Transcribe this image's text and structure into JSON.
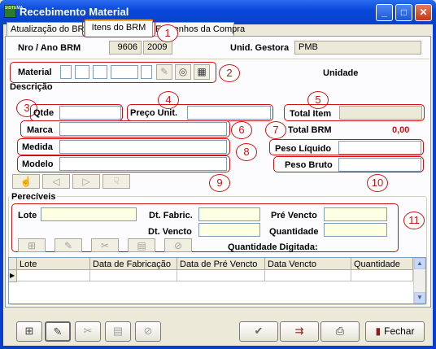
{
  "window": {
    "title": "Recebimento Material",
    "app_icon_text": "SISTEMA",
    "minimize": "_",
    "maximize": "□",
    "close": "✕"
  },
  "tabs": [
    {
      "label": "Atualização do BRM"
    },
    {
      "label": "Itens do BRM"
    },
    {
      "label": "Empenhos da Compra"
    }
  ],
  "header": {
    "nro_label": "Nro / Ano BRM",
    "nro_value": "9606",
    "ano_value": "2009",
    "unidade_label": "Unid. Gestora",
    "unidade_value": "PMB"
  },
  "item": {
    "material_label": "Material",
    "unidade_label": "Unidade",
    "descricao_label": "Descrição",
    "qtde_label": "Qtde",
    "preco_label": "Preço Unit.",
    "total_item_label": "Total Item",
    "marca_label": "Marca",
    "total_brm_label": "Total BRM",
    "total_brm_value": "0,00",
    "medida_label": "Medida",
    "peso_liquido_label": "Peso Líquido",
    "modelo_label": "Modelo",
    "peso_bruto_label": "Peso Bruto"
  },
  "pereciveis": {
    "title": "Perecíveis",
    "lote_label": "Lote",
    "dt_fabric_label": "Dt. Fabric.",
    "pre_vencto_label": "Pré Vencto",
    "dt_vencto_label": "Dt. Vencto",
    "quantidade_label": "Quantidade",
    "qtd_digitada_label": "Quantidade Digitada:",
    "columns": [
      "Lote",
      "Data de Fabricação",
      "Data de Pré Vencto",
      "Data Vencto",
      "Quantidade"
    ],
    "row_indicator": "▶"
  },
  "annotations": [
    "1",
    "2",
    "3",
    "4",
    "5",
    "6",
    "7",
    "8",
    "9",
    "10",
    "11"
  ],
  "footer": {
    "confirm_icon": "✔",
    "fechar_label": "Fechar"
  },
  "colors": {
    "title_bar": "#0a48dc",
    "annotation": "#d01010",
    "total_brm": "#d01010",
    "tab_highlight": "#f5a623"
  }
}
